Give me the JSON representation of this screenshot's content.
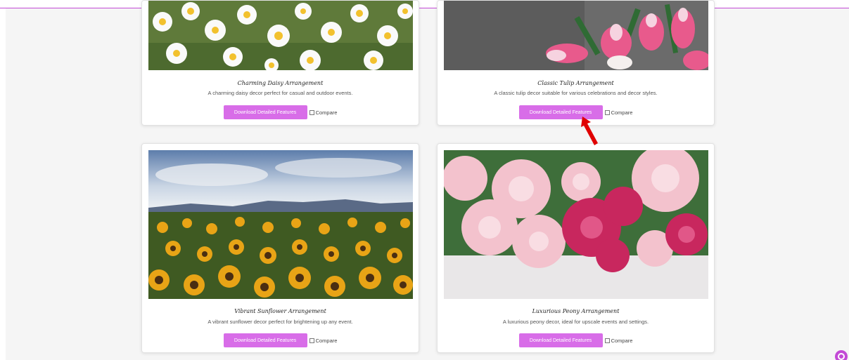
{
  "cards": [
    {
      "title": "Charming Daisy Arrangement",
      "description": "A charming daisy decor perfect for casual and outdoor events.",
      "button_label": "Download Detailed Features",
      "compare_label": "Compare"
    },
    {
      "title": "Classic Tulip Arrangement",
      "description": "A classic tulip decor suitable for various celebrations and decor styles.",
      "button_label": "Download Detailed Features",
      "compare_label": "Compare"
    },
    {
      "title": "Vibrant Sunflower Arrangement",
      "description": "A vibrant sunflower decor perfect for brightening up any event.",
      "button_label": "Download Detailed Features",
      "compare_label": "Compare"
    },
    {
      "title": "Luxurious Peony Arrangement",
      "description": "A luxurious peony decor, ideal for upscale events and settings.",
      "button_label": "Download Detailed Features",
      "compare_label": "Compare"
    }
  ],
  "colors": {
    "accent": "#d86de8",
    "brand_line": "#c34ad6",
    "annotation_arrow": "#e00000"
  },
  "icons": {
    "help": "help-circle-icon",
    "arrow": "red-arrow-annotation-icon"
  }
}
